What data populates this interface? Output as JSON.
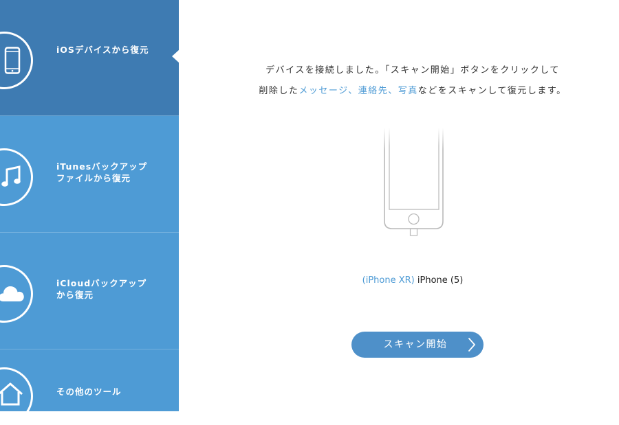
{
  "sidebar": {
    "items": [
      {
        "id": "ios",
        "lines": [
          "iOSデバイスから復元"
        ],
        "icon": "smartphone-icon",
        "active": true
      },
      {
        "id": "itunes",
        "lines": [
          "iTunesバックアップ",
          "ファイルから復元"
        ],
        "icon": "music-note-icon",
        "active": false
      },
      {
        "id": "icloud",
        "lines": [
          "iCloudバックアップ",
          "から復元"
        ],
        "icon": "cloud-icon",
        "active": false
      },
      {
        "id": "tools",
        "lines": [
          "その他のツール"
        ],
        "icon": "home-icon",
        "active": false
      }
    ]
  },
  "main": {
    "instruction": {
      "line1": "デバイスを接続しました。「スキャン開始」ボタンをクリックして",
      "line2_prefix": "削除した",
      "line2_highlight": "メッセージ、連絡先、写真",
      "line2_suffix": "などをスキャンして復元します。"
    },
    "device": {
      "model": "(iPhone XR)",
      "name": " iPhone (5)"
    },
    "scan_button": {
      "label": "スキャン開始",
      "icon": "chevron-right-icon"
    }
  },
  "colors": {
    "sidebar_bg": "#4e9bd5",
    "sidebar_active_bg": "#3e7bb2",
    "accent": "#4e9bd5",
    "button_bg": "#4e90c9"
  }
}
